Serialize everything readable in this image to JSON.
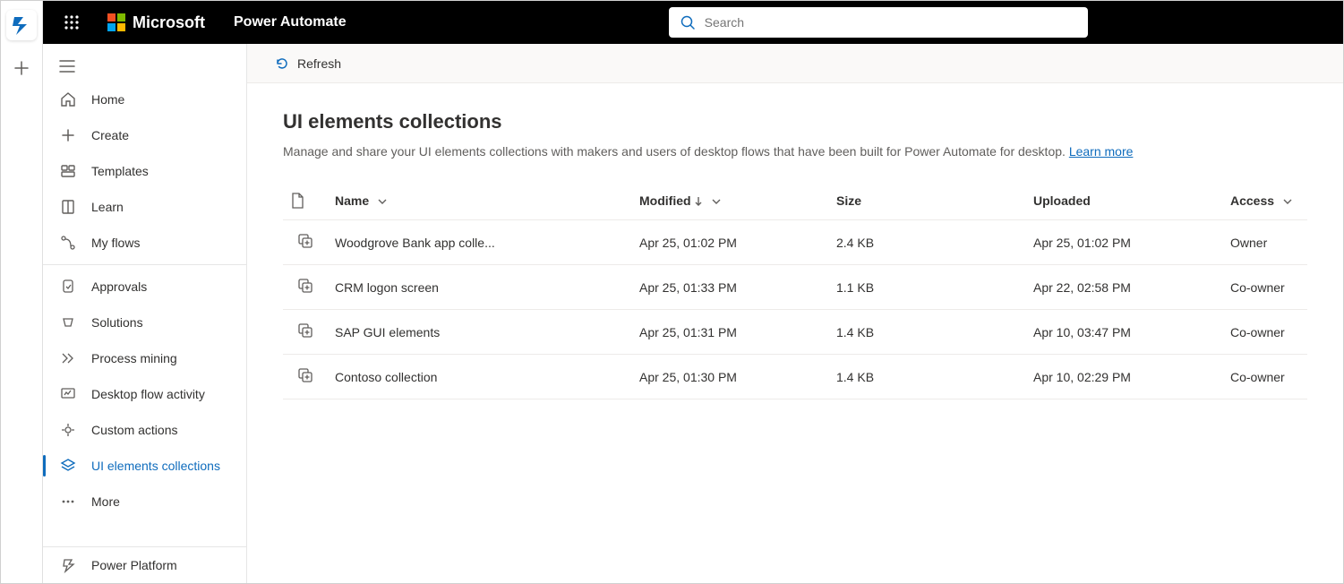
{
  "brand": {
    "company": "Microsoft",
    "product": "Power Automate"
  },
  "search": {
    "placeholder": "Search"
  },
  "rail": {
    "add_tooltip": "New"
  },
  "sidebar": {
    "items": [
      {
        "label": "Home"
      },
      {
        "label": "Create"
      },
      {
        "label": "Templates"
      },
      {
        "label": "Learn"
      },
      {
        "label": "My flows"
      },
      {
        "label": "Approvals"
      },
      {
        "label": "Solutions"
      },
      {
        "label": "Process mining"
      },
      {
        "label": "Desktop flow activity"
      },
      {
        "label": "Custom actions"
      },
      {
        "label": "UI elements collections"
      },
      {
        "label": "More"
      }
    ],
    "footer": {
      "label": "Power Platform"
    }
  },
  "cmdbar": {
    "refresh": "Refresh"
  },
  "page": {
    "title": "UI elements collections",
    "subtitle": "Manage and share your UI elements collections with makers and users of desktop flows that have been built for Power Automate for desktop. ",
    "learn_more": "Learn more"
  },
  "table": {
    "headers": {
      "name": "Name",
      "modified": "Modified",
      "size": "Size",
      "uploaded": "Uploaded",
      "access": "Access"
    },
    "rows": [
      {
        "name": "Woodgrove Bank app colle...",
        "modified": "Apr 25, 01:02 PM",
        "size": "2.4 KB",
        "uploaded": "Apr 25, 01:02 PM",
        "access": "Owner"
      },
      {
        "name": "CRM logon screen",
        "modified": "Apr 25, 01:33 PM",
        "size": "1.1 KB",
        "uploaded": "Apr 22, 02:58 PM",
        "access": "Co-owner"
      },
      {
        "name": "SAP GUI elements",
        "modified": "Apr 25, 01:31 PM",
        "size": "1.4 KB",
        "uploaded": "Apr 10, 03:47 PM",
        "access": "Co-owner"
      },
      {
        "name": "Contoso collection",
        "modified": "Apr 25, 01:30 PM",
        "size": "1.4 KB",
        "uploaded": "Apr 10, 02:29 PM",
        "access": "Co-owner"
      }
    ]
  }
}
